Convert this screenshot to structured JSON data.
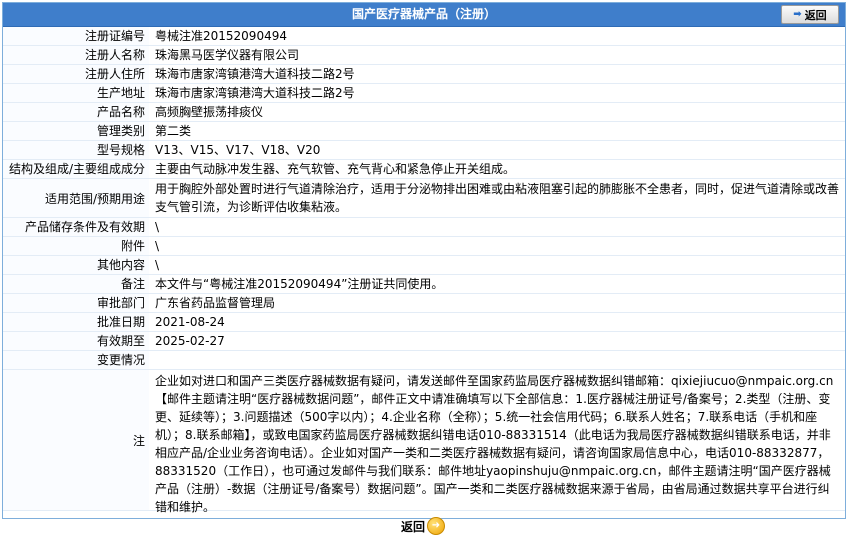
{
  "header": {
    "title": "国产医疗器械产品（注册）",
    "back_label": "返回"
  },
  "fields": [
    {
      "label": "注册证编号",
      "value": "粤械注准20152090494"
    },
    {
      "label": "注册人名称",
      "value": "珠海黑马医学仪器有限公司"
    },
    {
      "label": "注册人住所",
      "value": "珠海市唐家湾镇港湾大道科技二路2号"
    },
    {
      "label": "生产地址",
      "value": "珠海市唐家湾镇港湾大道科技二路2号"
    },
    {
      "label": "产品名称",
      "value": "高频胸壁振荡排痰仪"
    },
    {
      "label": "管理类别",
      "value": "第二类"
    },
    {
      "label": "型号规格",
      "value": "V13、V15、V17、V18、V20"
    },
    {
      "label": "结构及组成/主要组成成分",
      "value": "主要由气动脉冲发生器、充气软管、充气背心和紧急停止开关组成。"
    },
    {
      "label": "适用范围/预期用途",
      "value": "用于胸腔外部处置时进行气道清除治疗，适用于分泌物排出困难或由粘液阻塞引起的肺膨胀不全患者，同时，促进气道清除或改善支气管引流，为诊断评估收集粘液。"
    },
    {
      "label": "产品储存条件及有效期",
      "value": "\\"
    },
    {
      "label": "附件",
      "value": "\\"
    },
    {
      "label": "其他内容",
      "value": "\\"
    },
    {
      "label": "备注",
      "value": "本文件与“粤械注准20152090494”注册证共同使用。"
    },
    {
      "label": "审批部门",
      "value": "广东省药品监督管理局"
    },
    {
      "label": "批准日期",
      "value": "2021-08-24"
    },
    {
      "label": "有效期至",
      "value": "2025-02-27"
    },
    {
      "label": "变更情况",
      "value": ""
    },
    {
      "label": "注",
      "value": "企业如对进口和国产三类医疗器械数据有疑问，请发送邮件至国家药监局医疗器械数据纠错邮箱：qixiejiucuo@nmpaic.org.cn【邮件主题请注明“医疗器械数据问题”，邮件正文中请准确填写以下全部信息：1.医疗器械注册证号/备案号；2.类型（注册、变更、延续等）；3.问题描述（500字以内）；4.企业名称（全称）；5.统一社会信用代码；6.联系人姓名；7.联系电话（手机和座机）；8.联系邮箱】，或致电国家药监局医疗器械数据纠错电话010-88331514（此电话为我局医疗器械数据纠错联系电话，并非相应产品/企业业务咨询电话）。企业如对国产一类和二类医疗器械数据有疑问，请咨询国家局信息中心，电话010-88332877，88331520（工作日），也可通过发邮件与我们联系：邮件地址yaopinshuju@nmpaic.org.cn，邮件主题请注明“国产医疗器械产品（注册）-数据（注册证号/备案号）数据问题”。国产一类和二类医疗器械数据来源于省局，由省局通过数据共享平台进行纠错和维护。"
    }
  ],
  "footer": {
    "back_label": "返回"
  }
}
